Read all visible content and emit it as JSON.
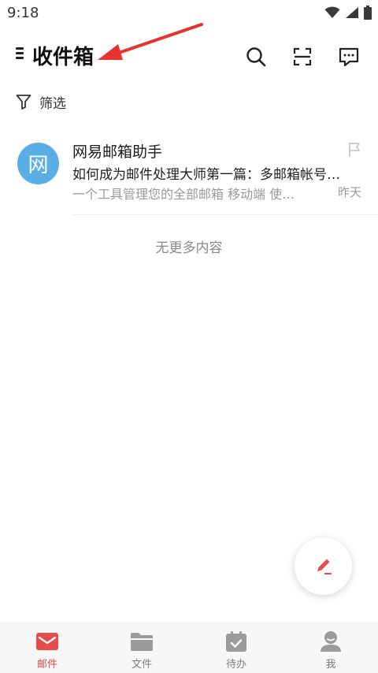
{
  "status_bar": {
    "time": "9:18"
  },
  "header": {
    "title": "收件箱"
  },
  "filter": {
    "label": "筛选"
  },
  "mails": [
    {
      "avatar_text": "网",
      "sender": "网易邮箱助手",
      "subject": "如何成为邮件处理大师第一篇：多邮箱帐号…",
      "preview": "一个工具管理您的全部邮箱 移动端 使…",
      "date": "昨天"
    }
  ],
  "list_end_text": "无更多内容",
  "bottom_nav": [
    {
      "label": "邮件",
      "icon": "mail-icon",
      "active": true
    },
    {
      "label": "文件",
      "icon": "folder-icon",
      "active": false
    },
    {
      "label": "待办",
      "icon": "todo-icon",
      "active": false
    },
    {
      "label": "我",
      "icon": "profile-icon",
      "active": false
    }
  ],
  "colors": {
    "accent": "#e94a4a",
    "avatar": "#5aaee6",
    "nav_bg": "#f7f7f7",
    "inactive_icon": "#9b9b9b"
  }
}
